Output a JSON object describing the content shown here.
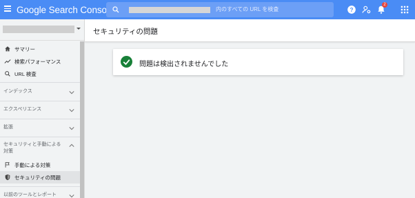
{
  "app": {
    "brand": "Google Search Console"
  },
  "search": {
    "suffix_text": "内のすべての URL を検査"
  },
  "header": {
    "notification_count": "2",
    "icons": [
      "help-icon",
      "account-settings-icon",
      "notifications-icon",
      "apps-grid-icon"
    ]
  },
  "sidebar": {
    "top_items": [
      {
        "label": "サマリー",
        "icon": "home-icon"
      },
      {
        "label": "検索パフォーマンス",
        "icon": "trending-icon"
      },
      {
        "label": "URL 検査",
        "icon": "search-icon"
      }
    ],
    "sections": [
      {
        "label": "インデックス",
        "expanded": false
      },
      {
        "label": "エクスペリエンス",
        "expanded": false
      },
      {
        "label": "拡張",
        "expanded": false
      },
      {
        "label_line1": "セキュリティと手動による",
        "label_line2": "対策",
        "expanded": true
      },
      {
        "label": "以前のツールとレポート",
        "expanded": false
      }
    ],
    "security_items": [
      {
        "label": "手動による対策",
        "icon": "flag-icon",
        "active": false
      },
      {
        "label": "セキュリティの問題",
        "icon": "shield-icon",
        "active": true
      }
    ]
  },
  "main": {
    "title": "セキュリティの問題",
    "status_message": "問題は検出されませんでした",
    "status_color": "#188038"
  }
}
